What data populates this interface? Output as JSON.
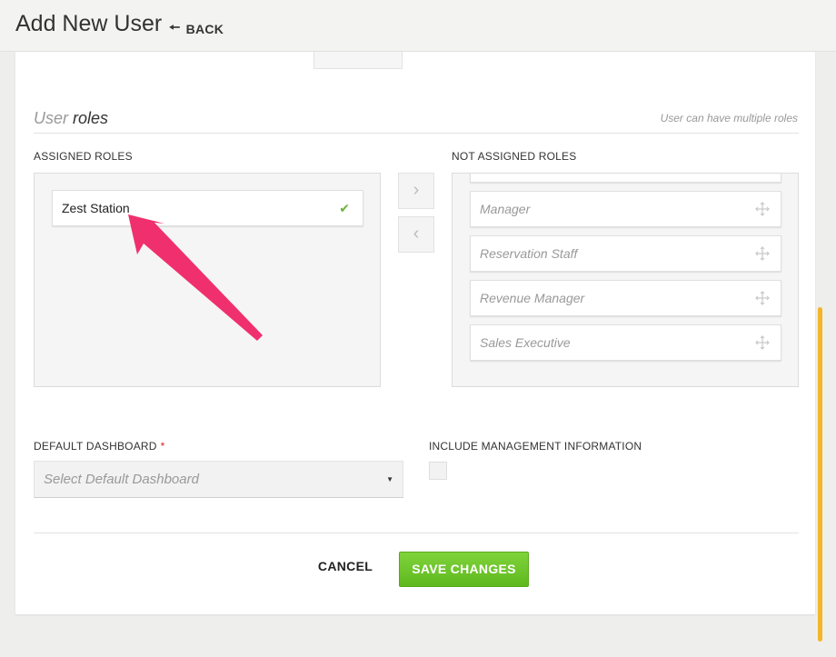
{
  "header": {
    "title": "Add New User",
    "back_label": "BACK",
    "back_icon": "left-arrow-icon"
  },
  "user_roles": {
    "title_light": "User",
    "title_strong": "roles",
    "hint": "User can have multiple roles",
    "assigned_label": "ASSIGNED ROLES",
    "not_assigned_label": "NOT ASSIGNED ROLES",
    "assigned": [
      {
        "label": "Zest Station",
        "icon": "check-icon"
      }
    ],
    "not_assigned": [
      {
        "label": "Manager",
        "icon": "move-icon"
      },
      {
        "label": "Reservation Staff",
        "icon": "move-icon"
      },
      {
        "label": "Revenue Manager",
        "icon": "move-icon"
      },
      {
        "label": "Sales Executive",
        "icon": "move-icon"
      }
    ],
    "move_right_icon": "chevron-right-icon",
    "move_left_icon": "chevron-left-icon"
  },
  "dashboard": {
    "label": "DEFAULT DASHBOARD",
    "required_mark": "*",
    "placeholder": "Select Default Dashboard"
  },
  "management": {
    "label": "INCLUDE MANAGEMENT INFORMATION",
    "checked": false
  },
  "actions": {
    "cancel_label": "CANCEL",
    "save_label": "SAVE CHANGES"
  },
  "colors": {
    "accent_green": "#6cc12a",
    "check_green": "#6cb33f",
    "annotation_pink": "#f0306e",
    "scrollbar": "#f5b529",
    "required_red": "#e02020"
  }
}
